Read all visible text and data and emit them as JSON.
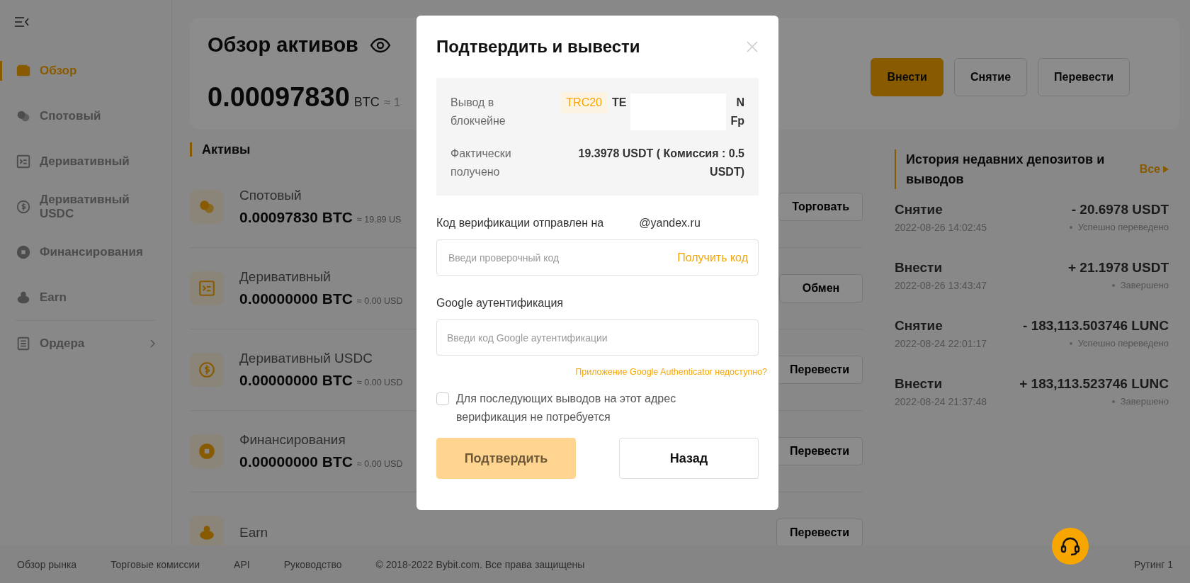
{
  "sidebar": {
    "items": [
      {
        "label": "Обзор",
        "selected": true,
        "kind": "link"
      },
      {
        "label": "Спотовый",
        "selected": false,
        "kind": "link"
      },
      {
        "label": "Деривативный",
        "selected": false,
        "kind": "link"
      },
      {
        "label": "Деривативный USDC",
        "selected": false,
        "kind": "link"
      },
      {
        "label": "Финансирования",
        "selected": false,
        "kind": "link"
      },
      {
        "label": "Earn",
        "selected": false,
        "kind": "link"
      },
      {
        "label": "Ордера",
        "selected": false,
        "kind": "group"
      }
    ]
  },
  "overview": {
    "title": "Обзор активов",
    "total": "0.00097830",
    "currency": "BTC",
    "approx": "≈ 1",
    "buttons": [
      {
        "label": "Внести",
        "kind": "primary"
      },
      {
        "label": "Снятие",
        "kind": "default"
      },
      {
        "label": "Перевести",
        "kind": "default"
      }
    ]
  },
  "assets": {
    "title": "Активы",
    "rows": [
      {
        "name": "Спотовый",
        "amount": "0.00097830 BTC",
        "approx": "≈ 19.89 US",
        "buttons": [
          "Торговать"
        ]
      },
      {
        "name": "Деривативный",
        "amount": "0.00000000 BTC",
        "approx": "≈ 0.00 USD",
        "buttons": [
          "Обмен"
        ]
      },
      {
        "name": "Деривативный USDC",
        "amount": "0.00000000 BTC",
        "approx": "≈ 0.00 USD",
        "buttons": [
          "Перевести"
        ]
      },
      {
        "name": "Финансирования",
        "amount": "0.00000000 BTC",
        "approx": "≈ 0.00 USD",
        "buttons": [
          "Перевести"
        ]
      },
      {
        "name": "Earn",
        "buttons": [
          "Перевести"
        ]
      }
    ]
  },
  "history": {
    "title": "История недавних депозитов и выводов",
    "link": "Все",
    "items": [
      {
        "type": "Снятие",
        "amount": "- 20.6978 USDT",
        "time": "2022-08-26 14:02:45",
        "status": "Успешно переведено"
      },
      {
        "type": "Внести",
        "amount": "+ 21.1978 USDT",
        "time": "2022-08-26 13:43:47",
        "status": "Завершено"
      },
      {
        "type": "Снятие",
        "amount": "- 183,113.503746 LUNC",
        "time": "2022-08-24 22:01:17",
        "status": "Успешно переведено"
      },
      {
        "type": "Внести",
        "amount": "+ 183,113.523746 LUNC",
        "time": "2022-08-24 21:37:48",
        "status": "Завершено"
      }
    ]
  },
  "footer": {
    "links": [
      "Обзор рынка",
      "Торговые комиссии",
      "API",
      "Руководство"
    ],
    "copyright": "© 2018-2022 Bybit.com. Все права защищены",
    "right": "Рутинг 1"
  },
  "modal": {
    "title": "Подтвердить и вывести",
    "chain": {
      "label": "Вывод в блокчейне",
      "network": "TRC20",
      "address_start": "TE",
      "address_end_1": "N",
      "address_end_2": "Fp"
    },
    "received": {
      "label": "Фактически получено",
      "value": "19.3978 USDT ( Комиссия : 0.5 USDT)"
    },
    "email_label": "Код верификации отправлен на",
    "email": "@yandex.ru",
    "code_field": {
      "placeholder": "Введи проверочный код",
      "action": "Получить код"
    },
    "google_label": "Google аутентификация",
    "google_field": {
      "placeholder": "Введи код Google аутентификации"
    },
    "google_help": "Приложение Google Authenticator недоступно?",
    "remember": {
      "label": "Для последующих выводов на этот адрес верификация не потребуется",
      "checked": false
    },
    "confirm": {
      "label": "Подтвердить",
      "disabled": true
    },
    "back": {
      "label": "Назад"
    }
  }
}
